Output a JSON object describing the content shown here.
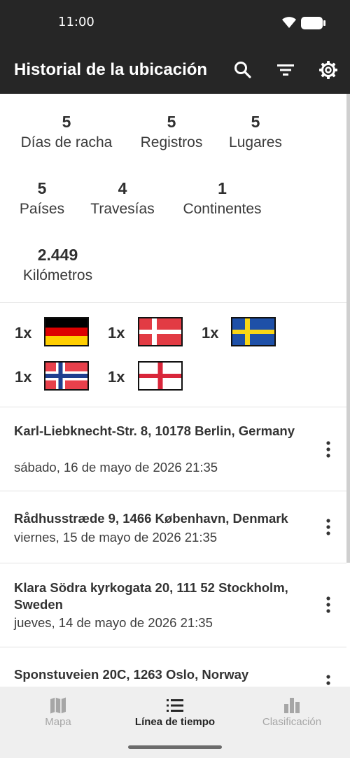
{
  "status_bar": {
    "time": "11:00"
  },
  "app_bar": {
    "title": "Historial de la ubicación"
  },
  "stats": [
    {
      "value": "5",
      "label": "Días de racha"
    },
    {
      "value": "5",
      "label": "Registros"
    },
    {
      "value": "5",
      "label": "Lugares"
    },
    {
      "value": "5",
      "label": "Países"
    },
    {
      "value": "4",
      "label": "Travesías"
    },
    {
      "value": "1",
      "label": "Continentes"
    },
    {
      "value": "2.449",
      "label": "Kilómetros"
    }
  ],
  "flags": [
    {
      "count": "1x",
      "country": "germany"
    },
    {
      "count": "1x",
      "country": "denmark"
    },
    {
      "count": "1x",
      "country": "sweden"
    },
    {
      "count": "1x",
      "country": "norway"
    },
    {
      "count": "1x",
      "country": "england"
    }
  ],
  "history": [
    {
      "address": "Karl-Liebknecht-Str. 8, 10178 Berlin, Germany",
      "date": "sábado, 16 de mayo de 2026 21:35"
    },
    {
      "address": "Rådhusstræde 9, 1466 København, Denmark",
      "date": "viernes, 15 de mayo de 2026 21:35"
    },
    {
      "address": "Klara Södra kyrkogata 20, 111 52 Stockholm, Sweden",
      "date": "jueves, 14 de mayo de 2026 21:35"
    },
    {
      "address": "Sponstuveien 20C, 1263 Oslo, Norway",
      "date": ""
    }
  ],
  "bottom_nav": {
    "items": [
      {
        "label": "Mapa",
        "icon": "map-icon",
        "active": false
      },
      {
        "label": "Línea de tiempo",
        "icon": "timeline-list-icon",
        "active": true
      },
      {
        "label": "Clasificación",
        "icon": "bar-chart-icon",
        "active": false
      }
    ]
  },
  "colors": {
    "app_bar": "#262626",
    "nav_bg": "#efefef",
    "inactive": "#a6a6a6"
  }
}
